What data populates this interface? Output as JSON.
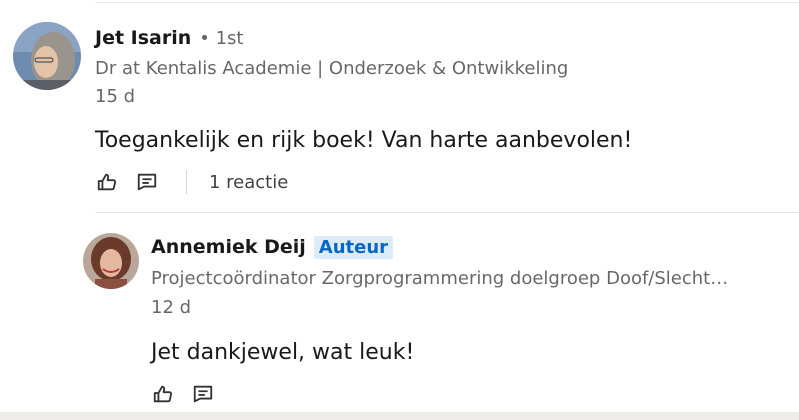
{
  "comments": [
    {
      "author": "Jet Isarin",
      "degree": "• 1st",
      "headline": "Dr at Kentalis Academie | Onderzoek & Ontwikkeling",
      "timestamp": "15 d",
      "text": "Toegankelijk en rijk boek! Van harte aanbevolen!",
      "reply_count": "1 reactie",
      "icons": [
        "like-icon",
        "comment-icon"
      ]
    }
  ],
  "reply": {
    "author": "Annemiek Deij",
    "badge": "Auteur",
    "headline": "Projectcoördinator Zorgprogrammering doelgroep Doof/Slecht…",
    "timestamp": "12 d",
    "text": "Jet dankjewel, wat leuk!",
    "icons": [
      "like-icon",
      "comment-icon"
    ]
  },
  "colors": {
    "badge_bg": "#dcebf8",
    "badge_text": "#0a66c2",
    "secondary_text": "#666666"
  }
}
